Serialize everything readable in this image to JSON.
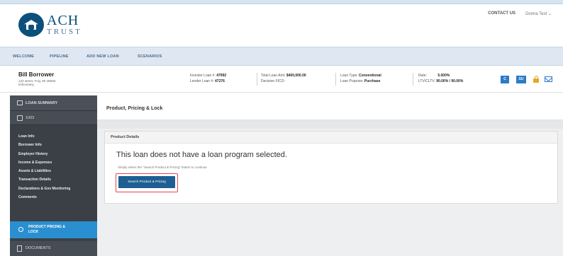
{
  "brand": {
    "line1": "ACH",
    "line2": "TRUST"
  },
  "header": {
    "contact": "CONTACT US",
    "user": "Donna Test ⌄"
  },
  "nav": [
    "WELCOME",
    "PIPELINE",
    "ADD NEW LOAN",
    "SCENARIOS"
  ],
  "borrower": {
    "name": "Bill Borrower",
    "address": "123 street, Troy, MI 48083",
    "company": "imfcomany"
  },
  "loan": {
    "investor_label": "Investor Loan #:",
    "investor_value": "47992",
    "lender_label": "Lender Loan #:",
    "lender_value": "47276",
    "total_label": "Total Loan Amt:",
    "total_value": "$400,000.00",
    "decision_label": "Decision FICO:",
    "decision_value": "",
    "type_label": "Loan Type:",
    "type_value": "Conventional",
    "purpose_label": "Loan Purpose:",
    "purpose_value": "Purchase",
    "rate_label": "Rate:",
    "rate_value": "5.000%",
    "ltv_label": "LTV/CLTV:",
    "ltv_value": "90.00% / 90.00%"
  },
  "actions": {
    "btn1": "C",
    "btn2": "SU"
  },
  "sidebar": {
    "summary": "LOAN SUMMARY",
    "section": "1003",
    "items": [
      "Loan Info",
      "Borrower Info",
      "Employer History",
      "Income & Expenses",
      "Assets & Liabilities",
      "Transaction Details",
      "Declarations & Gov Monitoring",
      "Comments"
    ],
    "active_line1": "PRODUCT PRICING &",
    "active_line2": "LOCK",
    "documents": "DOCUMENTS"
  },
  "main": {
    "title": "Product, Pricing & Lock",
    "panel_title": "Product Details",
    "message": "This loan does not have a loan program selected.",
    "hint": "Simply select the \"Search Product & Pricing\" button to continue",
    "button": "Search Product & Pricing"
  },
  "colors": {
    "brand": "#0b4f7c",
    "sidebar": "#3b4047",
    "active": "#2a8fd0",
    "button": "#1e5f93",
    "highlight": "#e0474c"
  }
}
